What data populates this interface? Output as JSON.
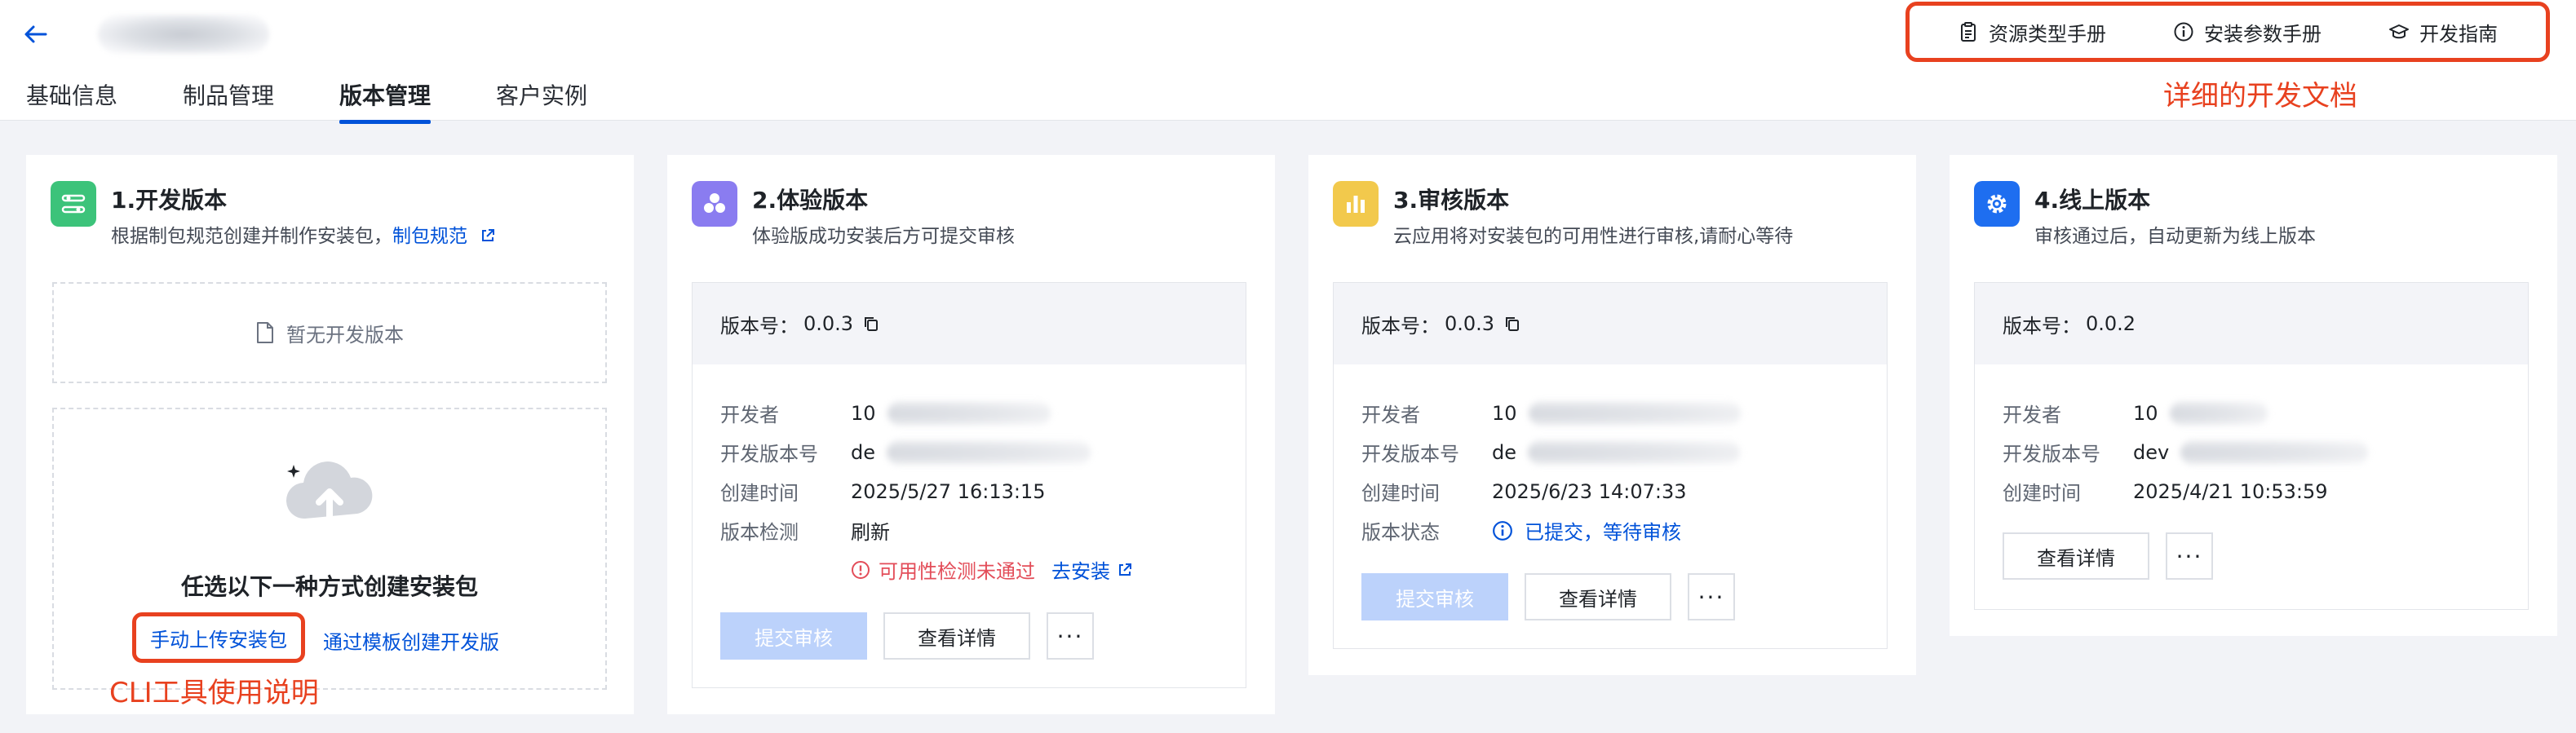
{
  "header": {
    "tabs": [
      {
        "label": "基础信息",
        "active": false
      },
      {
        "label": "制品管理",
        "active": false
      },
      {
        "label": "版本管理",
        "active": true
      },
      {
        "label": "客户实例",
        "active": false
      }
    ],
    "doc_links": [
      {
        "label": "资源类型手册",
        "icon": "clipboard-icon"
      },
      {
        "label": "安装参数手册",
        "icon": "info-circle-icon"
      },
      {
        "label": "开发指南",
        "icon": "graduation-cap-icon"
      }
    ],
    "doc_annotation": "详细的开发文档"
  },
  "cards": {
    "dev": {
      "title": "1.开发版本",
      "desc": "根据制包规范创建并制作安装包，",
      "desc_link": "制包规范",
      "empty_text": "暂无开发版本",
      "create_title": "任选以下一种方式创建安装包",
      "manual_upload": "手动上传安装包",
      "template_create": "通过模板创建开发版",
      "cli_annotation": "CLI工具使用说明",
      "icon_color": "#3cc37a"
    },
    "trial": {
      "title": "2.体验版本",
      "desc": "体验版成功安装后方可提交审核",
      "version_label": "版本号：",
      "version": "0.0.3",
      "rows": {
        "developer_label": "开发者",
        "developer_value": "10",
        "dev_version_label": "开发版本号",
        "dev_version_value": "de",
        "created_label": "创建时间",
        "created_value": "2025/5/27 16:13:15",
        "check_label": "版本检测",
        "refresh": "刷新",
        "check_fail": "可用性检测未通过",
        "go_install": "去安装"
      },
      "submit": "提交审核",
      "details": "查看详情",
      "more": "···",
      "icon_color": "#8a7cf0"
    },
    "review": {
      "title": "3.审核版本",
      "desc": "云应用将对安装包的可用性进行审核,请耐心等待",
      "version_label": "版本号：",
      "version": "0.0.3",
      "rows": {
        "developer_label": "开发者",
        "developer_value": "10",
        "dev_version_label": "开发版本号",
        "dev_version_value": "de",
        "created_label": "创建时间",
        "created_value": "2025/6/23 14:07:33",
        "status_label": "版本状态",
        "status_value": "已提交，等待审核"
      },
      "submit": "提交审核",
      "details": "查看详情",
      "more": "···",
      "icon_color": "#f2c94c"
    },
    "online": {
      "title": "4.线上版本",
      "desc": "审核通过后，自动更新为线上版本",
      "version_label": "版本号：",
      "version": "0.0.2",
      "rows": {
        "developer_label": "开发者",
        "developer_value": "10",
        "dev_version_label": "开发版本号",
        "dev_version_value": "dev",
        "created_label": "创建时间",
        "created_value": "2025/4/21 10:53:59"
      },
      "details": "查看详情",
      "more": "···",
      "icon_color": "#1e6ef0"
    }
  },
  "colors": {
    "accent": "#0052d9",
    "annotation": "#e8411f",
    "error": "#e34d59"
  }
}
